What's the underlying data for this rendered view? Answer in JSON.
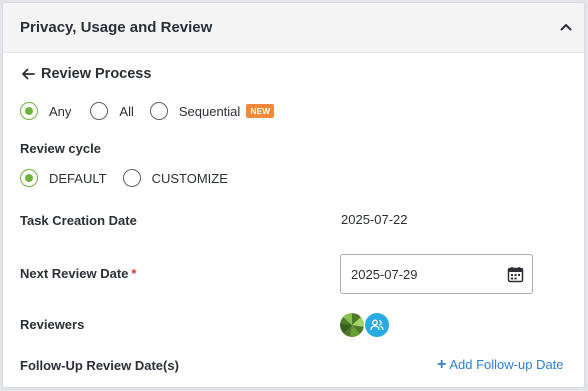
{
  "panel": {
    "title": "Privacy, Usage and Review"
  },
  "review_process": {
    "title": "Review Process",
    "options": [
      {
        "label": "Any",
        "checked": true
      },
      {
        "label": "All",
        "checked": false
      },
      {
        "label": "Sequential",
        "checked": false,
        "badge": "NEW"
      }
    ]
  },
  "review_cycle": {
    "label": "Review cycle",
    "options": [
      {
        "label": "DEFAULT",
        "checked": true
      },
      {
        "label": "CUSTOMIZE",
        "checked": false
      }
    ]
  },
  "task_creation": {
    "label": "Task Creation Date",
    "value": "2025-07-22"
  },
  "next_review": {
    "label": "Next Review Date",
    "required_mark": "*",
    "value": "2025-07-29"
  },
  "reviewers": {
    "label": "Reviewers"
  },
  "follow_up": {
    "label": "Follow-Up Review Date(s)",
    "add_label": "Add Follow-up Date",
    "add_icon": "+"
  },
  "icons": {
    "collapse": "chevron-up-icon",
    "back": "arrow-left-icon",
    "calendar": "calendar-icon",
    "group": "group-user-icon"
  },
  "colors": {
    "accent_green": "#6fb33f",
    "badge_orange": "#f08a3a",
    "link_blue": "#2f7fd1",
    "avatar_blue": "#29abe2",
    "required_red": "#d9362b"
  }
}
